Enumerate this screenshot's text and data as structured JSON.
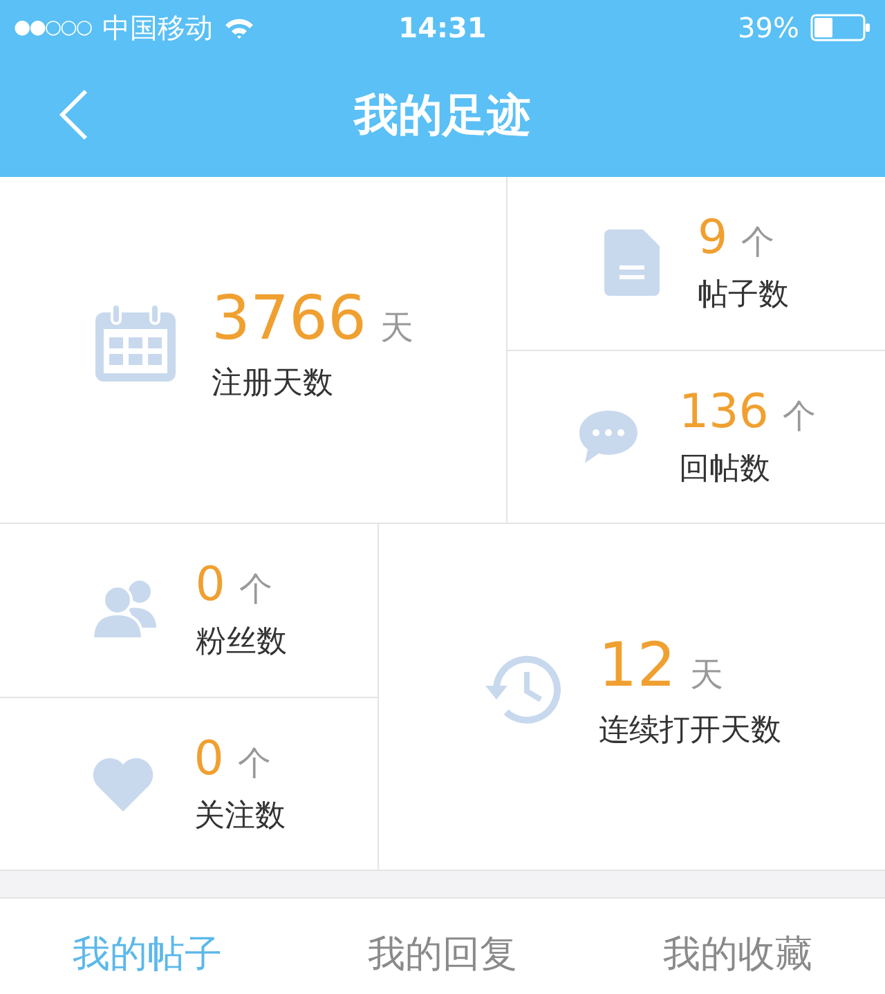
{
  "status_bar": {
    "signal": "●●○○○",
    "carrier": "中国移动",
    "time": "14:31",
    "battery": "39%"
  },
  "nav": {
    "title": "我的足迹"
  },
  "registration": {
    "value": "3766",
    "unit": "天",
    "label": "注册天数"
  },
  "posts": {
    "value": "9",
    "unit": "个",
    "label": "帖子数"
  },
  "replies": {
    "value": "136",
    "unit": "个",
    "label": "回帖数"
  },
  "fans": {
    "value": "0",
    "unit": "个",
    "label": "粉丝数"
  },
  "following": {
    "value": "0",
    "unit": "个",
    "label": "关注数"
  },
  "streak": {
    "value": "12",
    "unit": "天",
    "label": "连续打开天数"
  },
  "tabs": [
    {
      "label": "我的帖子",
      "selected": true
    },
    {
      "label": "我的回复",
      "selected": false
    },
    {
      "label": "我的收藏",
      "selected": false
    }
  ]
}
